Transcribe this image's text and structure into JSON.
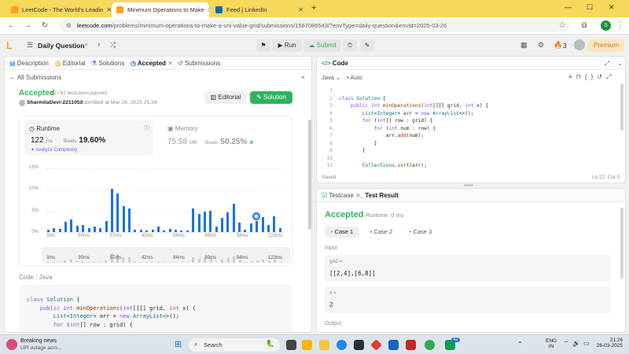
{
  "browser": {
    "tabs": [
      {
        "title": "LeetCode - The World's Leadin",
        "favicon_color": "#ffa116",
        "active": false
      },
      {
        "title": "Minimum Operations to Make",
        "favicon_color": "#ffa116",
        "active": true
      },
      {
        "title": "Feed | LinkedIn",
        "favicon_color": "#0a66c2",
        "active": false
      }
    ],
    "new_tab": "+",
    "url_host": "leetcode.com",
    "url_rest": "/problems/minimum-operations-to-make-a-uni-value-grid/submissions/1587086543/?envType=daily-question&envId=2025-03-26",
    "profile_initial": "S"
  },
  "header": {
    "daily_question": "Daily Question",
    "run_label": "Run",
    "submit_label": "Submit",
    "streak": "3",
    "premium_label": "Premium"
  },
  "left_tabs": {
    "description": "Description",
    "editorial": "Editorial",
    "solutions": "Solutions",
    "accepted": "Accepted",
    "submissions": "Submissions"
  },
  "submission": {
    "all_submissions": "All Submissions",
    "status": "Accepted",
    "testcases": "62 / 62 testcases passed",
    "user": "SharmilaDevi-2211052",
    "submitted_at": "submitted at Mar 26, 2025 21:26",
    "editorial_btn": "Editorial",
    "solution_btn": "Solution",
    "runtime_label": "Runtime",
    "runtime_value": "122",
    "runtime_unit": "ms",
    "beats_label": "Beats",
    "runtime_beats": "19.60%",
    "analyze": "Analyze Complexity",
    "memory_label": "Memory",
    "memory_value": "75.58",
    "memory_unit": "MB",
    "memory_beats": "50.25%",
    "code_label": "Code",
    "lang_label": "Java"
  },
  "chart_data": {
    "type": "bar",
    "y_ticks": [
      "15%",
      "10%",
      "5%",
      "0%"
    ],
    "ylim": [
      0,
      15
    ],
    "x_tick_labels": [
      "3ms",
      "30ms",
      "57ms",
      "42ms",
      "84ms",
      "89ms",
      "94ms",
      "123ms"
    ],
    "values": [
      0.5,
      1,
      0.7,
      2.3,
      3,
      1.4,
      1.7,
      0.9,
      1.2,
      1.0,
      2.5,
      10,
      9,
      6,
      5.5,
      0.6,
      0.6,
      0.4,
      0.5,
      1.2,
      0.4,
      0.8,
      0.5,
      0.4,
      0.3,
      5.5,
      4.3,
      4.8,
      5.0,
      1.2,
      3.3,
      4.6,
      6.5,
      2.2,
      0.5,
      2,
      2.5,
      3.4,
      1.6,
      3.6,
      1
    ],
    "highlight_index": 36
  },
  "code_panel": {
    "title": "Code",
    "language": "Java",
    "mode": "Auto",
    "saved": "Saved",
    "cursor": "Ln 22, Col 3",
    "lines": [
      "",
      "class Solution {",
      "    public int minOperations(int[][] grid, int x) {",
      "        List<Integer> arr = new ArrayList<>();",
      "        for (int[] row : grid) {",
      "            for (int num : row) {",
      "                arr.add(num);",
      "            }",
      "        }",
      "",
      "        Collections.sort(arr);"
    ],
    "line_numbers": [
      "1",
      "2",
      "3",
      "4",
      "5",
      "6",
      "7",
      "8",
      "9",
      "10",
      "11"
    ]
  },
  "bottom_code": {
    "lines": [
      "class Solution {",
      "    public int minOperations(int[][] grid, int x) {",
      "        List<Integer> arr = new ArrayList<>();",
      "        for (int[] row : grid) {"
    ]
  },
  "result": {
    "testcase_tab": "Testcase",
    "result_tab": "Test Result",
    "status": "Accepted",
    "runtime": "Runtime: 0 ms",
    "cases": [
      "Case 1",
      "Case 2",
      "Case 3"
    ],
    "input_label": "Input",
    "grid_label": "grid =",
    "grid_value": "[[2,4],[6,8]]",
    "x_label": "x =",
    "x_value": "2",
    "output_label": "Output"
  },
  "taskbar": {
    "news_title": "Breaking news",
    "news_sub": "UPI outage acro...",
    "search_label": "Search",
    "lang_top": "ENG",
    "lang_bottom": "IN",
    "time": "21:26",
    "date": "26-03-2025",
    "badge": "42"
  }
}
